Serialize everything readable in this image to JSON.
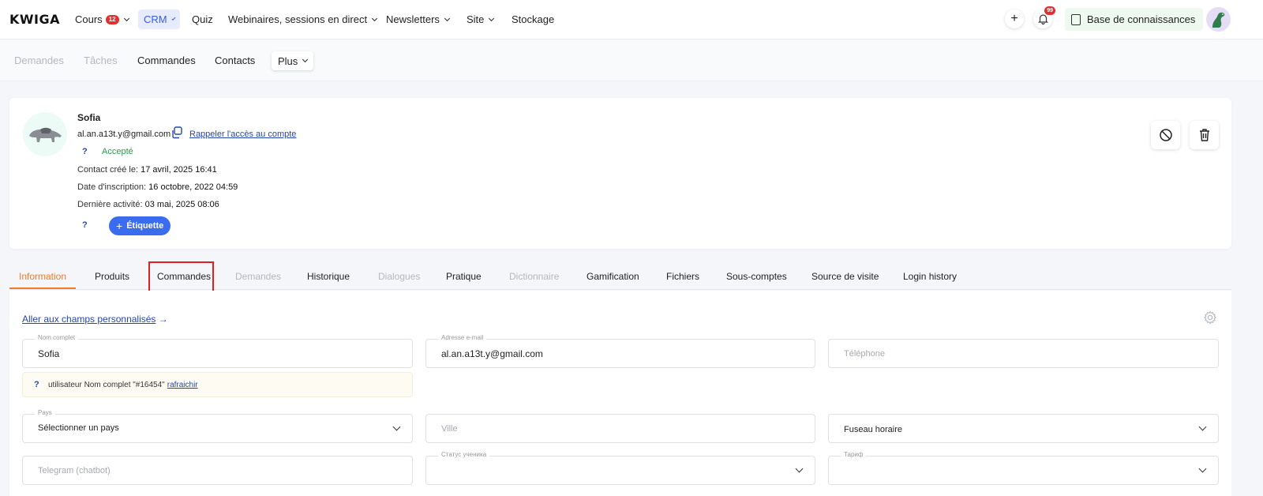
{
  "topnav": {
    "logo": "KWIGA",
    "items": [
      {
        "label": "Cours",
        "badge": "12",
        "dropdown": true
      },
      {
        "label": "CRM",
        "dropdown": true,
        "active": true
      },
      {
        "label": "Quiz"
      },
      {
        "label": "Webinaires, sessions en direct",
        "dropdown": true
      },
      {
        "label": "Newsletters",
        "dropdown": true
      },
      {
        "label": "Site",
        "dropdown": true
      },
      {
        "label": "Stockage"
      }
    ],
    "add_label": "+",
    "notifications_badge": "99",
    "knowledge_base": "Base de connaissances"
  },
  "subnav": {
    "items": [
      {
        "label": "Demandes",
        "disabled": true
      },
      {
        "label": "Tâches",
        "disabled": true
      },
      {
        "label": "Commandes"
      },
      {
        "label": "Contacts"
      }
    ],
    "more_label": "Plus"
  },
  "profile": {
    "name": "Sofia",
    "email": "al.an.a13t.y@gmail.com",
    "recall_link": "Rappeler l'accès au compte",
    "help_mark": "?",
    "status": "Accepté",
    "created_label": "Contact créé le:",
    "created_value": "17 avril, 2025 16:41",
    "signup_label": "Date d'inscription:",
    "signup_value": "16 octobre, 2022 04:59",
    "last_activity_label": "Dernière activité:",
    "last_activity_value": "03 mai, 2025 08:06",
    "tag_button": "Étiquette",
    "colors": {
      "accent": "#3b6cf0",
      "status": "#2b9a4b"
    }
  },
  "tabs": [
    {
      "label": "Information",
      "active": true
    },
    {
      "label": "Produits"
    },
    {
      "label": "Commandes",
      "highlighted": true
    },
    {
      "label": "Demandes",
      "disabled": true
    },
    {
      "label": "Historique"
    },
    {
      "label": "Dialogues",
      "disabled": true
    },
    {
      "label": "Pratique"
    },
    {
      "label": "Dictionnaire",
      "disabled": true
    },
    {
      "label": "Gamification"
    },
    {
      "label": "Fichiers"
    },
    {
      "label": "Sous-comptes"
    },
    {
      "label": "Source de visite"
    },
    {
      "label": "Login history"
    }
  ],
  "form": {
    "custom_fields_link": "Aller aux champs personnalisés",
    "custom_fields_arrow": "→",
    "full_name": {
      "label": "Nom complet",
      "value": "Sofia"
    },
    "email": {
      "label": "Adresse e-mail",
      "value": "al.an.a13t.y@gmail.com"
    },
    "phone": {
      "placeholder": "Téléphone"
    },
    "notice": {
      "mark": "?",
      "text": "utilisateur Nom complet \"#16454\"",
      "link": "rafraichir"
    },
    "country": {
      "label": "Pays",
      "value": "Sélectionner un pays"
    },
    "city": {
      "placeholder": "Ville"
    },
    "timezone": {
      "value": "Fuseau horaire"
    },
    "telegram": {
      "placeholder": "Telegram (chatbot)"
    },
    "student_status": {
      "label": "Статус ученика"
    },
    "tariff": {
      "label": "Тариф"
    }
  }
}
